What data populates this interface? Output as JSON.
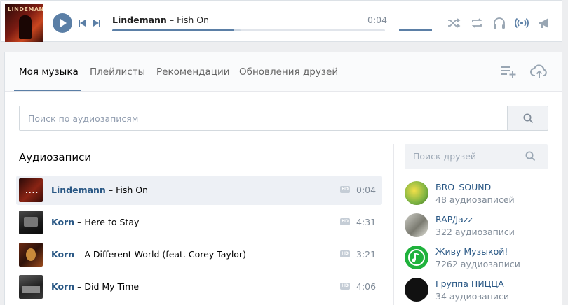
{
  "player": {
    "cover_text": "LINDEMANN",
    "artist": "Lindemann",
    "separator": "–",
    "song": "Fish On",
    "time": "0:04",
    "progress_fraction": 0.47,
    "volume_fraction": 1.0,
    "controls": [
      {
        "name": "shuffle-icon",
        "glyph": "⤮",
        "active": false
      },
      {
        "name": "repeat-icon",
        "glyph": "⟲",
        "active": false
      },
      {
        "name": "headphones-icon",
        "glyph": "♫",
        "active": false
      },
      {
        "name": "broadcast-icon",
        "glyph": "((•))",
        "active": true
      },
      {
        "name": "megaphone-icon",
        "glyph": "📢",
        "active": false
      }
    ]
  },
  "tabs": [
    {
      "label": "Моя музыка",
      "active": true
    },
    {
      "label": "Плейлисты",
      "active": false
    },
    {
      "label": "Рекомендации",
      "active": false
    },
    {
      "label": "Обновления друзей",
      "active": false
    }
  ],
  "search": {
    "placeholder": "Поиск по аудиозаписям"
  },
  "section_title": "Аудиозаписи",
  "hd_label": "HD",
  "tracks": [
    {
      "artist": "Lindemann",
      "dash": "–",
      "song": "Fish On",
      "duration": "0:04",
      "current": true
    },
    {
      "artist": "Korn",
      "dash": "–",
      "song": "Here to Stay",
      "duration": "4:31",
      "current": false
    },
    {
      "artist": "Korn",
      "dash": "–",
      "song": "A Different World (feat. Corey Taylor)",
      "duration": "3:21",
      "current": false
    },
    {
      "artist": "Korn",
      "dash": "–",
      "song": "Did My Time",
      "duration": "4:06",
      "current": false
    }
  ],
  "friend_search": {
    "placeholder": "Поиск друзей"
  },
  "groups": [
    {
      "name": "BRO_SOUND",
      "count": "48 аудиозаписей"
    },
    {
      "name": "RAP/Jazz",
      "count": "322 аудиозаписи"
    },
    {
      "name": "Живу Музыкой!",
      "count": "7262 аудиозаписи"
    },
    {
      "name": "Группа ПИЦЦА",
      "count": "34 аудиозаписи"
    }
  ],
  "colors": {
    "accent": "#5b7fa6",
    "link": "#2a5885",
    "muted": "#818c99"
  }
}
